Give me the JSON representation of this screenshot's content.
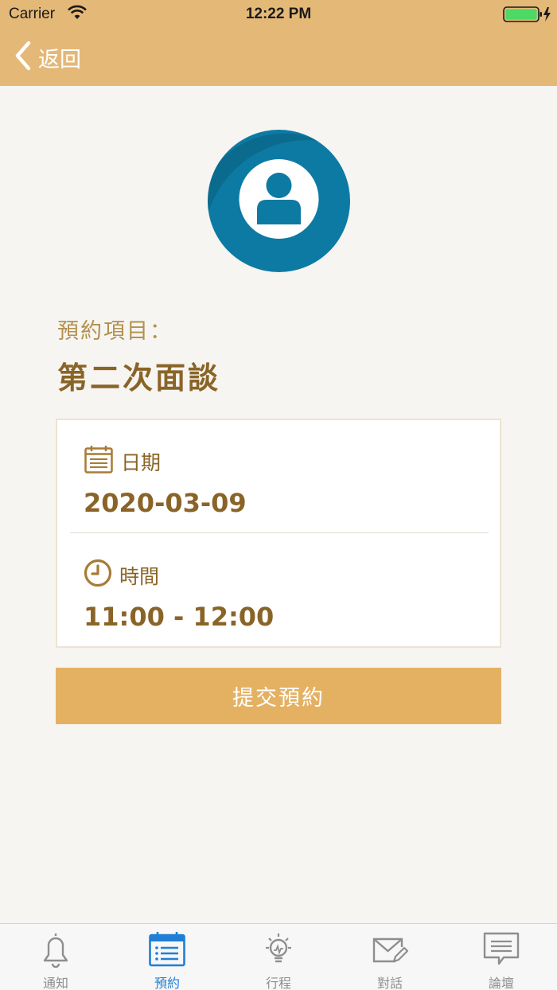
{
  "status_bar": {
    "carrier": "Carrier",
    "time": "12:22 PM"
  },
  "nav": {
    "back_label": "返回"
  },
  "colors": {
    "header": "#e4b877",
    "primary_text": "#8a6427",
    "label_text": "#b3904f",
    "button": "#e4b163",
    "avatar": "#0d7aa3",
    "tab_active": "#1f7fd6"
  },
  "appointment": {
    "item_label": "預約項目：",
    "item_value": "第二次面談",
    "date_label": "日期",
    "date_value": "2020-03-09",
    "time_label": "時間",
    "time_value": "11:00 - 12:00",
    "date_icon": "calendar-icon",
    "time_icon": "clock-icon"
  },
  "submit_label": "提交預約",
  "tabs": [
    {
      "label": "通知",
      "icon": "bell-icon",
      "active": false
    },
    {
      "label": "預約",
      "icon": "calendar-list-icon",
      "active": true
    },
    {
      "label": "行程",
      "icon": "lightbulb-icon",
      "active": false
    },
    {
      "label": "對話",
      "icon": "envelope-pen-icon",
      "active": false
    },
    {
      "label": "論壇",
      "icon": "chat-bubble-icon",
      "active": false
    }
  ]
}
